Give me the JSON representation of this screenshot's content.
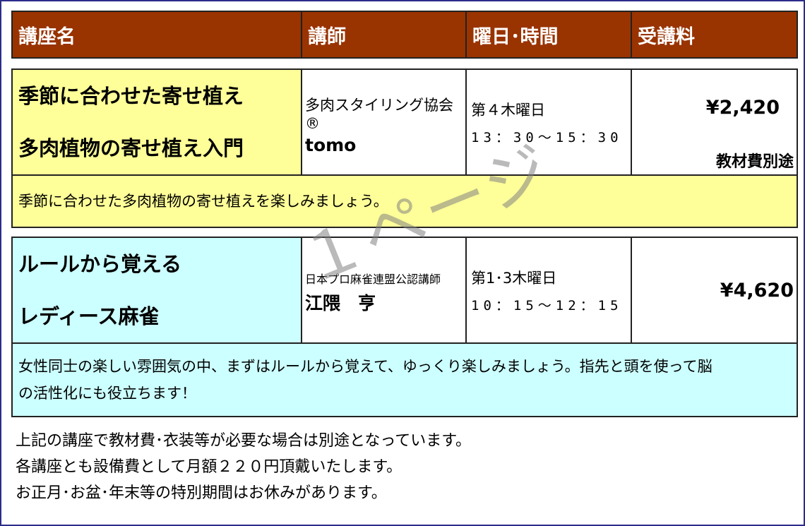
{
  "header": {
    "course": "講座名",
    "teacher": "講師",
    "schedule": "曜日･時間",
    "fee": "受講料"
  },
  "courses": [
    {
      "name_line1": "季節に合わせた寄せ植え",
      "name_line2": "多肉植物の寄せ植え入門",
      "org": "多肉スタイリング協会®",
      "teacher": "tomo",
      "day": "第４木曜日",
      "time": "13：30～15：30",
      "price": "¥2,420",
      "price_note": "教材費別途",
      "description": "季節に合わせた多肉植物の寄せ植えを楽しみましょう。"
    },
    {
      "name_line1": "ルールから覚える",
      "name_line2": "レディース麻雀",
      "org": "日本プロ麻雀連盟公認講師",
      "teacher": "江隈　亨",
      "day": "第1･3木曜日",
      "time": "10：15～12：15",
      "price": "¥4,620",
      "price_note": "",
      "description_line1": "女性同士の楽しい雰囲気の中、まずはルールから覚えて、ゆっくり楽しみましょう。指先と頭を使って脳",
      "description_line2": "の活性化にも役立ちます！"
    }
  ],
  "footer": [
    "上記の講座で教材費･衣装等が必要な場合は別途となっています。",
    "各講座とも設備費として月額２２０円頂戴いたします。",
    "お正月･お盆･年末等の特別期間はお休みがあります。"
  ],
  "watermark": "１ページ"
}
